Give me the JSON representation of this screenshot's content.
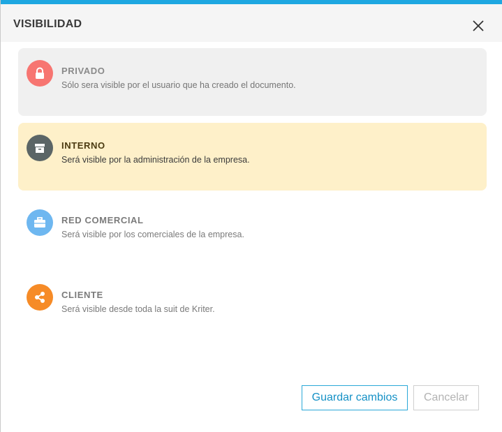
{
  "dialog": {
    "title": "VISIBILIDAD",
    "accent_color": "#1ea7e1"
  },
  "options": [
    {
      "id": "privado",
      "title": "PRIVADO",
      "description": "Sólo sera visible por el usuario que ha creado el documento.",
      "icon": "lock-icon",
      "icon_color": "#f77571",
      "selected": false
    },
    {
      "id": "interno",
      "title": "INTERNO",
      "description": "Será visible por la administración de la empresa.",
      "icon": "archive-box-icon",
      "icon_color": "#5b6566",
      "selected": true
    },
    {
      "id": "red-comercial",
      "title": "RED COMERCIAL",
      "description": "Será visible por los comerciales de la empresa.",
      "icon": "briefcase-icon",
      "icon_color": "#6eb7f0",
      "selected": false
    },
    {
      "id": "cliente",
      "title": "CLIENTE",
      "description": "Será visible desde toda la suit de Kriter.",
      "icon": "share-icon",
      "icon_color": "#f68b27",
      "selected": false
    }
  ],
  "footer": {
    "save_label": "Guardar cambios",
    "cancel_label": "Cancelar"
  }
}
